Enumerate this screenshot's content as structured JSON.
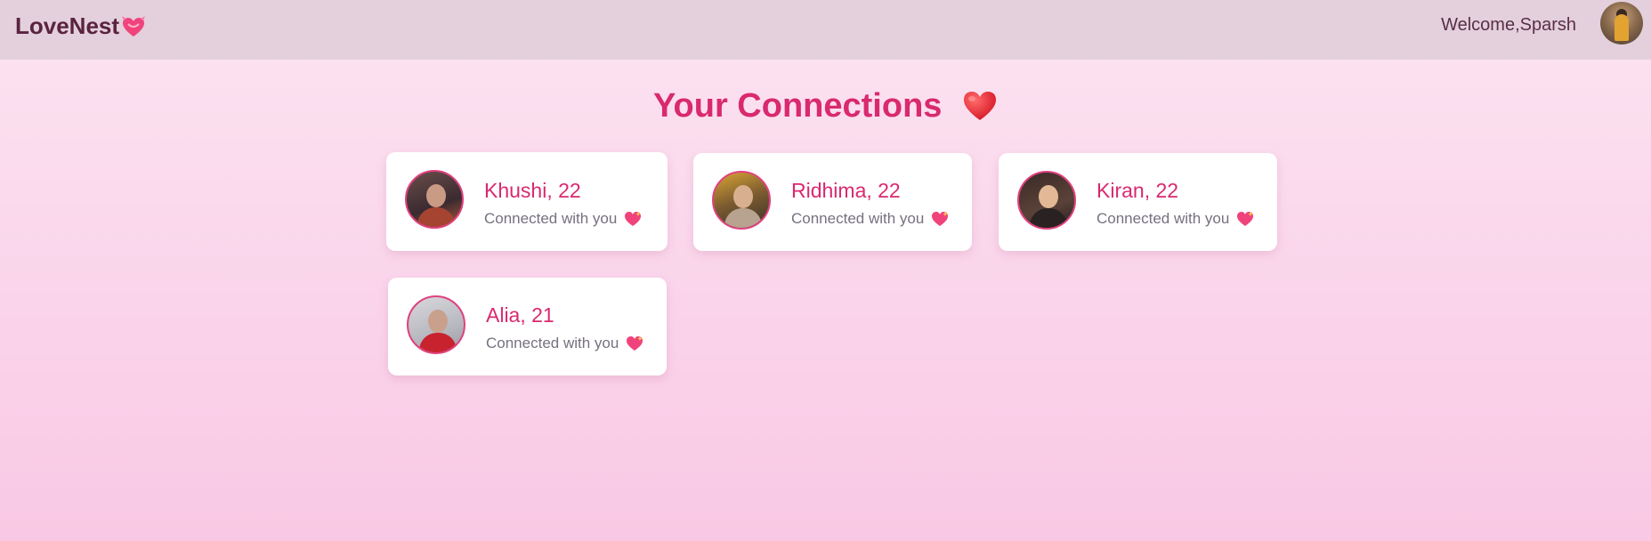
{
  "nav": {
    "brand": "LoveNest",
    "brand_icon": "heart-with-ribbon",
    "welcome": "Welcome,Sparsh",
    "avatar_icon": "user-avatar"
  },
  "page": {
    "title": "Your Connections",
    "title_icon": "red-heart"
  },
  "connections": [
    {
      "name": "Khushi, 22",
      "status": "Connected with you",
      "status_icon": "sparkling-heart"
    },
    {
      "name": "Ridhima, 22",
      "status": "Connected with you",
      "status_icon": "sparkling-heart"
    },
    {
      "name": "Kiran, 22",
      "status": "Connected with you",
      "status_icon": "sparkling-heart"
    },
    {
      "name": "Alia, 21",
      "status": "Connected with you",
      "status_icon": "sparkling-heart"
    }
  ],
  "colors": {
    "accent": "#d9296f",
    "navbar": "#e3d0dc",
    "brand_text": "#5a2340",
    "avatar_ring": "#e0417f"
  }
}
